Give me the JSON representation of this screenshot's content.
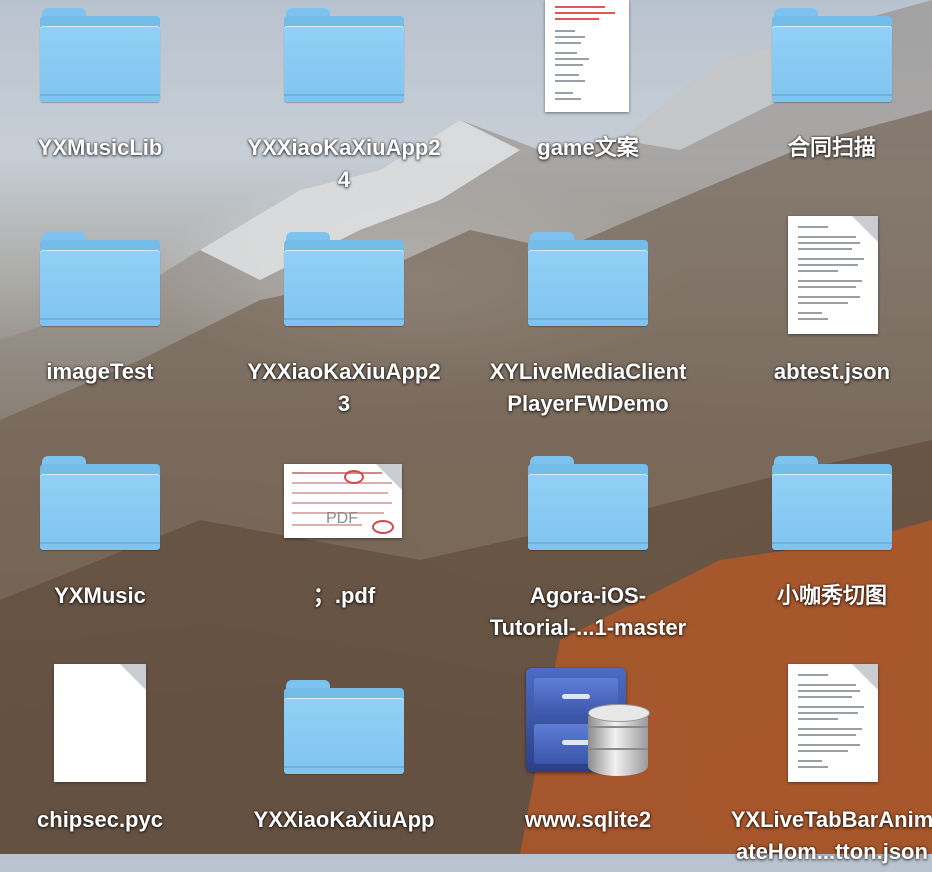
{
  "desktop": {
    "items": [
      {
        "name": "YXMusicLib",
        "kind": "folder"
      },
      {
        "name": "YXXiaoKaXiuApp2\n4",
        "kind": "folder"
      },
      {
        "name": "game文案",
        "kind": "document"
      },
      {
        "name": "合同扫描",
        "kind": "folder"
      },
      {
        "name": "imageTest",
        "kind": "folder"
      },
      {
        "name": "YXXiaoKaXiuApp2\n3",
        "kind": "folder"
      },
      {
        "name": "XYLiveMediaClient\nPlayerFWDemo",
        "kind": "folder"
      },
      {
        "name": "abtest.json",
        "kind": "text-file"
      },
      {
        "name": "YXMusic",
        "kind": "folder"
      },
      {
        "name": "；.pdf",
        "kind": "pdf"
      },
      {
        "name": "Agora-iOS-\nTutorial-...1-master",
        "kind": "folder"
      },
      {
        "name": "小咖秀切图",
        "kind": "folder"
      },
      {
        "name": "chipsec.pyc",
        "kind": "blank-file"
      },
      {
        "name": "YXXiaoKaXiuApp",
        "kind": "folder"
      },
      {
        "name": "www.sqlite2",
        "kind": "database"
      },
      {
        "name": "YXLiveTabBarAnim\nateHom...tton.json",
        "kind": "text-file"
      }
    ],
    "pdf_badge": "PDF",
    "colors": {
      "folder": "#7fc4ef",
      "label": "#ffffff"
    }
  }
}
